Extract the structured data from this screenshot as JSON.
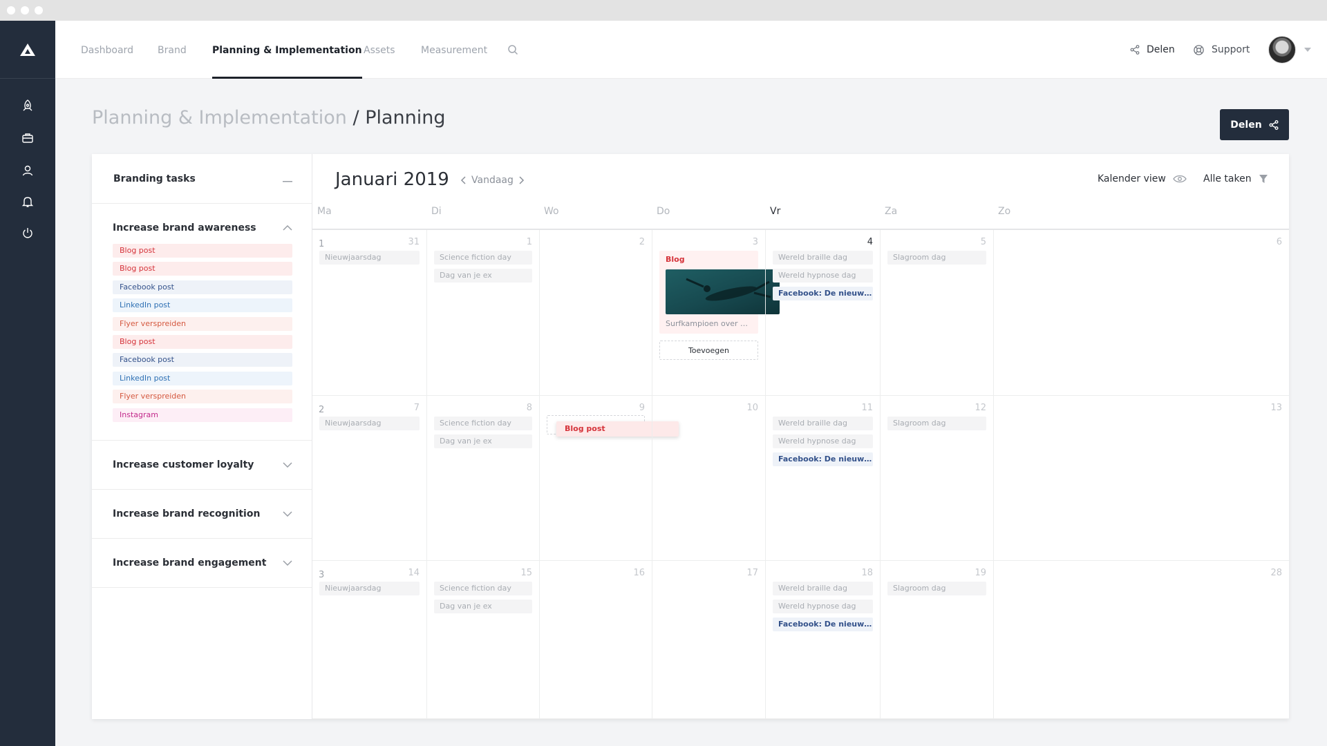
{
  "nav": {
    "tabs": [
      {
        "label": "Dashboard",
        "active": false
      },
      {
        "label": "Brand",
        "active": false
      },
      {
        "label": "Planning & Implementation",
        "active": true
      },
      {
        "label": "Assets",
        "active": false
      },
      {
        "label": "Measurement",
        "active": false
      }
    ],
    "share_label": "Delen",
    "support_label": "Support"
  },
  "page": {
    "breadcrumb": "Planning & Implementation",
    "title": "/ Planning",
    "share_button": "Delen"
  },
  "tasks": {
    "title": "Branding tasks",
    "groups": [
      {
        "title": "Increase brand awareness",
        "expanded": true,
        "items": [
          {
            "label": "Blog post",
            "kind": "blog"
          },
          {
            "label": "Blog post",
            "kind": "blog"
          },
          {
            "label": "Facebook post",
            "kind": "facebook"
          },
          {
            "label": "LinkedIn post",
            "kind": "linkedin"
          },
          {
            "label": "Flyer verspreiden",
            "kind": "flyer"
          },
          {
            "label": "Blog post",
            "kind": "blog"
          },
          {
            "label": "Facebook post",
            "kind": "facebook"
          },
          {
            "label": "LinkedIn post",
            "kind": "linkedin"
          },
          {
            "label": "Flyer verspreiden",
            "kind": "flyer"
          },
          {
            "label": "Instagram",
            "kind": "instagram"
          }
        ]
      },
      {
        "title": "Increase customer loyalty",
        "expanded": false,
        "items": []
      },
      {
        "title": "Increase brand recognition",
        "expanded": false,
        "items": []
      },
      {
        "title": "Increase brand engagement",
        "expanded": false,
        "items": []
      }
    ]
  },
  "colors": {
    "blog": {
      "bg": "#fdecec",
      "fg": "#d5333a"
    },
    "facebook": {
      "bg": "#eef2f8",
      "fg": "#33518a"
    },
    "linkedin": {
      "bg": "#edf4fb",
      "fg": "#2d6fb3"
    },
    "flyer": {
      "bg": "#fdf0ee",
      "fg": "#d4583f"
    },
    "instagram": {
      "bg": "#fdeef6",
      "fg": "#c2298a"
    },
    "sidebar": "#232d3c"
  },
  "calendar": {
    "month": "Januari 2019",
    "today_label": "Vandaag",
    "view_label": "Kalender view",
    "filter_label": "Alle taken",
    "weekdays": [
      "Ma",
      "Di",
      "Wo",
      "Do",
      "Vr",
      "Za",
      "Zo"
    ],
    "today_weekday": "Vr",
    "weeks": [
      {
        "week": "1",
        "days": [
          {
            "day": "31",
            "events": [
              {
                "label": "Nieuwjaarsdag",
                "kind": "holiday"
              }
            ]
          },
          {
            "day": "1",
            "events": [
              {
                "label": "Science fiction day",
                "kind": "holiday"
              },
              {
                "label": "Dag van je ex",
                "kind": "holiday"
              }
            ]
          },
          {
            "day": "2",
            "events": []
          },
          {
            "day": "3",
            "events": [],
            "card": {
              "label": "Blog",
              "caption": "Surfkampioen over de beste g...",
              "add_label": "Toevoegen"
            }
          },
          {
            "day": "4",
            "today": true,
            "events": [
              {
                "label": "Wereld braille dag",
                "kind": "holiday"
              },
              {
                "label": "Wereld hypnose dag",
                "kind": "holiday"
              },
              {
                "label": "Facebook: De nieuw op...",
                "kind": "fb"
              }
            ]
          },
          {
            "day": "5",
            "events": [
              {
                "label": "Slagroom dag",
                "kind": "holiday"
              }
            ]
          },
          {
            "day": "6",
            "events": []
          }
        ]
      },
      {
        "week": "2",
        "days": [
          {
            "day": "7",
            "events": [
              {
                "label": "Nieuwjaarsdag",
                "kind": "holiday"
              }
            ]
          },
          {
            "day": "8",
            "events": [
              {
                "label": "Science fiction day",
                "kind": "holiday"
              },
              {
                "label": "Dag van je ex",
                "kind": "holiday"
              }
            ]
          },
          {
            "day": "9",
            "events": [],
            "dragging": {
              "label": "Blog post"
            }
          },
          {
            "day": "10",
            "events": []
          },
          {
            "day": "11",
            "events": [
              {
                "label": "Wereld braille dag",
                "kind": "holiday"
              },
              {
                "label": "Wereld hypnose dag",
                "kind": "holiday"
              },
              {
                "label": "Facebook: De nieuw op...",
                "kind": "fb"
              }
            ]
          },
          {
            "day": "12",
            "events": [
              {
                "label": "Slagroom dag",
                "kind": "holiday"
              }
            ]
          },
          {
            "day": "13",
            "events": []
          }
        ]
      },
      {
        "week": "3",
        "days": [
          {
            "day": "14",
            "events": [
              {
                "label": "Nieuwjaarsdag",
                "kind": "holiday"
              }
            ]
          },
          {
            "day": "15",
            "events": [
              {
                "label": "Science fiction day",
                "kind": "holiday"
              },
              {
                "label": "Dag van je ex",
                "kind": "holiday"
              }
            ]
          },
          {
            "day": "16",
            "events": []
          },
          {
            "day": "17",
            "events": []
          },
          {
            "day": "18",
            "events": [
              {
                "label": "Wereld braille dag",
                "kind": "holiday"
              },
              {
                "label": "Wereld hypnose dag",
                "kind": "holiday"
              },
              {
                "label": "Facebook: De nieuw op...",
                "kind": "fb"
              }
            ]
          },
          {
            "day": "19",
            "events": [
              {
                "label": "Slagroom dag",
                "kind": "holiday"
              }
            ]
          },
          {
            "day": "28",
            "events": []
          }
        ]
      }
    ]
  }
}
